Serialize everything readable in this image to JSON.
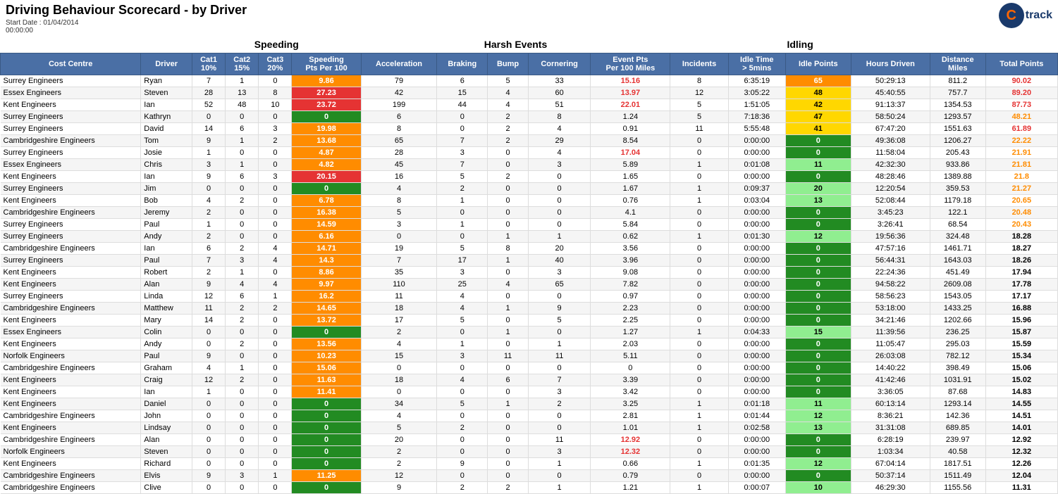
{
  "title": "Driving Behaviour Scorecard - by Driver",
  "date_label": "Start Date : 01/04/2014",
  "time_label": "00:00:00",
  "logo_c": "C",
  "logo_track": "track",
  "section_headers": [
    {
      "label": "",
      "colspan": 2
    },
    {
      "label": "Speeding",
      "colspan": 4
    },
    {
      "label": "Harsh Events",
      "colspan": 5
    },
    {
      "label": "Idling",
      "colspan": 4
    },
    {
      "label": "",
      "colspan": 3
    }
  ],
  "col_headers": [
    "Cost Centre",
    "Driver",
    "Cat1 10%",
    "Cat2 15%",
    "Cat3 20%",
    "Speeding Pts Per 100",
    "Acceleration",
    "Braking",
    "Bump",
    "Cornering",
    "Event Pts Per 100 Miles",
    "Incidents",
    "Idle Time > 5mins",
    "Idle Points",
    "Hours Driven",
    "Distance Miles",
    "Total Points"
  ],
  "rows": [
    {
      "cost_centre": "Surrey Engineers",
      "driver": "Ryan",
      "cat1": 7,
      "cat2": 1,
      "cat3": 0,
      "speed_pts": "9.86",
      "speed_class": "orange",
      "accel": 79,
      "braking": 6,
      "bump": 5,
      "cornering": 33,
      "event_pts": "15.16",
      "event_class": "red",
      "incidents": 8,
      "idle_time": "6:35:19",
      "idle_pts": "65",
      "idle_pts_class": "orange",
      "hours": "50:29:13",
      "distance": "811.2",
      "total": "90.02",
      "total_class": "red"
    },
    {
      "cost_centre": "Essex Engineers",
      "driver": "Steven",
      "cat1": 28,
      "cat2": 13,
      "cat3": 8,
      "speed_pts": "27.23",
      "speed_class": "red",
      "accel": 42,
      "braking": 15,
      "bump": 4,
      "cornering": 60,
      "event_pts": "13.97",
      "event_class": "normal",
      "incidents": 12,
      "idle_time": "3:05:22",
      "idle_pts": "48",
      "idle_pts_class": "yellow",
      "hours": "45:40:55",
      "distance": "757.7",
      "total": "89.20",
      "total_class": "red"
    },
    {
      "cost_centre": "Kent Engineers",
      "driver": "Ian",
      "cat1": 52,
      "cat2": 48,
      "cat3": 10,
      "speed_pts": "23.72",
      "speed_class": "red",
      "accel": 199,
      "braking": 44,
      "bump": 4,
      "cornering": 51,
      "event_pts": "22.01",
      "event_class": "red",
      "incidents": 5,
      "idle_time": "1:51:05",
      "idle_pts": "42",
      "idle_pts_class": "yellow",
      "hours": "91:13:37",
      "distance": "1354.53",
      "total": "87.73",
      "total_class": "red"
    },
    {
      "cost_centre": "Surrey Engineers",
      "driver": "Kathryn",
      "cat1": 0,
      "cat2": 0,
      "cat3": 0,
      "speed_pts": "0",
      "speed_class": "green",
      "accel": 6,
      "braking": 0,
      "bump": 2,
      "cornering": 8,
      "event_pts": "1.24",
      "event_class": "normal",
      "incidents": 5,
      "idle_time": "7:18:36",
      "idle_pts": "47",
      "idle_pts_class": "yellow",
      "hours": "58:50:24",
      "distance": "1293.57",
      "total": "48.21",
      "total_class": "orange"
    },
    {
      "cost_centre": "Surrey Engineers",
      "driver": "David",
      "cat1": 14,
      "cat2": 6,
      "cat3": 3,
      "speed_pts": "19.98",
      "speed_class": "orange",
      "accel": 8,
      "braking": 0,
      "bump": 2,
      "cornering": 4,
      "event_pts": "0.91",
      "event_class": "normal",
      "incidents": 11,
      "idle_time": "5:55:48",
      "idle_pts": "41",
      "idle_pts_class": "yellow",
      "hours": "67:47:20",
      "distance": "1551.63",
      "total": "61.89",
      "total_class": "red"
    },
    {
      "cost_centre": "Cambridgeshire Engineers",
      "driver": "Tom",
      "cat1": 9,
      "cat2": 1,
      "cat3": 2,
      "speed_pts": "13.68",
      "speed_class": "orange",
      "accel": 65,
      "braking": 7,
      "bump": 2,
      "cornering": 29,
      "event_pts": "8.54",
      "event_class": "normal",
      "incidents": 0,
      "idle_time": "0:00:00",
      "idle_pts": "0",
      "idle_pts_class": "green",
      "hours": "49:36:08",
      "distance": "1206.27",
      "total": "22.22",
      "total_class": "yellow"
    },
    {
      "cost_centre": "Surrey Engineers",
      "driver": "Josie",
      "cat1": 1,
      "cat2": 0,
      "cat3": 0,
      "speed_pts": "4.87",
      "speed_class": "orange",
      "accel": 28,
      "braking": 3,
      "bump": 0,
      "cornering": 4,
      "event_pts": "17.04",
      "event_class": "red",
      "incidents": 0,
      "idle_time": "0:00:00",
      "idle_pts": "0",
      "idle_pts_class": "green",
      "hours": "11:58:04",
      "distance": "205.43",
      "total": "21.91",
      "total_class": "yellow"
    },
    {
      "cost_centre": "Essex Engineers",
      "driver": "Chris",
      "cat1": 3,
      "cat2": 1,
      "cat3": 0,
      "speed_pts": "4.82",
      "speed_class": "orange",
      "accel": 45,
      "braking": 7,
      "bump": 0,
      "cornering": 3,
      "event_pts": "5.89",
      "event_class": "normal",
      "incidents": 1,
      "idle_time": "0:01:08",
      "idle_pts": "11",
      "idle_pts_class": "lime",
      "hours": "42:32:30",
      "distance": "933.86",
      "total": "21.81",
      "total_class": "yellow"
    },
    {
      "cost_centre": "Kent Engineers",
      "driver": "Ian",
      "cat1": 9,
      "cat2": 6,
      "cat3": 3,
      "speed_pts": "20.15",
      "speed_class": "red",
      "accel": 16,
      "braking": 5,
      "bump": 2,
      "cornering": 0,
      "event_pts": "1.65",
      "event_class": "normal",
      "incidents": 0,
      "idle_time": "0:00:00",
      "idle_pts": "0",
      "idle_pts_class": "green",
      "hours": "48:28:46",
      "distance": "1389.88",
      "total": "21.8",
      "total_class": "yellow"
    },
    {
      "cost_centre": "Surrey Engineers",
      "driver": "Jim",
      "cat1": 0,
      "cat2": 0,
      "cat3": 0,
      "speed_pts": "0",
      "speed_class": "green",
      "accel": 4,
      "braking": 2,
      "bump": 0,
      "cornering": 0,
      "event_pts": "1.67",
      "event_class": "normal",
      "incidents": 1,
      "idle_time": "0:09:37",
      "idle_pts": "20",
      "idle_pts_class": "lime",
      "hours": "12:20:54",
      "distance": "359.53",
      "total": "21.27",
      "total_class": "yellow"
    },
    {
      "cost_centre": "Kent Engineers",
      "driver": "Bob",
      "cat1": 4,
      "cat2": 2,
      "cat3": 0,
      "speed_pts": "6.78",
      "speed_class": "orange",
      "accel": 8,
      "braking": 1,
      "bump": 0,
      "cornering": 0,
      "event_pts": "0.76",
      "event_class": "normal",
      "incidents": 1,
      "idle_time": "0:03:04",
      "idle_pts": "13",
      "idle_pts_class": "lime",
      "hours": "52:08:44",
      "distance": "1179.18",
      "total": "20.65",
      "total_class": "yellow"
    },
    {
      "cost_centre": "Cambridgeshire Engineers",
      "driver": "Jeremy",
      "cat1": 2,
      "cat2": 0,
      "cat3": 0,
      "speed_pts": "16.38",
      "speed_class": "orange",
      "accel": 5,
      "braking": 0,
      "bump": 0,
      "cornering": 0,
      "event_pts": "4.1",
      "event_class": "normal",
      "incidents": 0,
      "idle_time": "0:00:00",
      "idle_pts": "0",
      "idle_pts_class": "green",
      "hours": "3:45:23",
      "distance": "122.1",
      "total": "20.48",
      "total_class": "yellow"
    },
    {
      "cost_centre": "Surrey Engineers",
      "driver": "Paul",
      "cat1": 1,
      "cat2": 0,
      "cat3": 0,
      "speed_pts": "14.59",
      "speed_class": "orange",
      "accel": 3,
      "braking": 1,
      "bump": 0,
      "cornering": 0,
      "event_pts": "5.84",
      "event_class": "normal",
      "incidents": 0,
      "idle_time": "0:00:00",
      "idle_pts": "0",
      "idle_pts_class": "green",
      "hours": "3:26:41",
      "distance": "68.54",
      "total": "20.43",
      "total_class": "yellow"
    },
    {
      "cost_centre": "Surrey Engineers",
      "driver": "Andy",
      "cat1": 2,
      "cat2": 0,
      "cat3": 0,
      "speed_pts": "6.16",
      "speed_class": "orange",
      "accel": 0,
      "braking": 0,
      "bump": 1,
      "cornering": 1,
      "event_pts": "0.62",
      "event_class": "normal",
      "incidents": 1,
      "idle_time": "0:01:30",
      "idle_pts": "12",
      "idle_pts_class": "lime",
      "hours": "19:56:36",
      "distance": "324.48",
      "total": "18.28",
      "total_class": "yellow"
    },
    {
      "cost_centre": "Cambridgeshire Engineers",
      "driver": "Ian",
      "cat1": 6,
      "cat2": 2,
      "cat3": 4,
      "speed_pts": "14.71",
      "speed_class": "orange",
      "accel": 19,
      "braking": 5,
      "bump": 8,
      "cornering": 20,
      "event_pts": "3.56",
      "event_class": "normal",
      "incidents": 0,
      "idle_time": "0:00:00",
      "idle_pts": "0",
      "idle_pts_class": "green",
      "hours": "47:57:16",
      "distance": "1461.71",
      "total": "18.27",
      "total_class": "yellow"
    },
    {
      "cost_centre": "Surrey Engineers",
      "driver": "Paul",
      "cat1": 7,
      "cat2": 3,
      "cat3": 4,
      "speed_pts": "14.3",
      "speed_class": "orange",
      "accel": 7,
      "braking": 17,
      "bump": 1,
      "cornering": 40,
      "event_pts": "3.96",
      "event_class": "normal",
      "incidents": 0,
      "idle_time": "0:00:00",
      "idle_pts": "0",
      "idle_pts_class": "green",
      "hours": "56:44:31",
      "distance": "1643.03",
      "total": "18.26",
      "total_class": "yellow"
    },
    {
      "cost_centre": "Kent Engineers",
      "driver": "Robert",
      "cat1": 2,
      "cat2": 1,
      "cat3": 0,
      "speed_pts": "8.86",
      "speed_class": "orange",
      "accel": 35,
      "braking": 3,
      "bump": 0,
      "cornering": 3,
      "event_pts": "9.08",
      "event_class": "normal",
      "incidents": 0,
      "idle_time": "0:00:00",
      "idle_pts": "0",
      "idle_pts_class": "green",
      "hours": "22:24:36",
      "distance": "451.49",
      "total": "17.94",
      "total_class": "yellow"
    },
    {
      "cost_centre": "Kent Engineers",
      "driver": "Alan",
      "cat1": 9,
      "cat2": 4,
      "cat3": 4,
      "speed_pts": "9.97",
      "speed_class": "orange",
      "accel": 110,
      "braking": 25,
      "bump": 4,
      "cornering": 65,
      "event_pts": "7.82",
      "event_class": "normal",
      "incidents": 0,
      "idle_time": "0:00:00",
      "idle_pts": "0",
      "idle_pts_class": "green",
      "hours": "94:58:22",
      "distance": "2609.08",
      "total": "17.78",
      "total_class": "yellow"
    },
    {
      "cost_centre": "Surrey Engineers",
      "driver": "Linda",
      "cat1": 12,
      "cat2": 6,
      "cat3": 1,
      "speed_pts": "16.2",
      "speed_class": "orange",
      "accel": 11,
      "braking": 4,
      "bump": 0,
      "cornering": 0,
      "event_pts": "0.97",
      "event_class": "normal",
      "incidents": 0,
      "idle_time": "0:00:00",
      "idle_pts": "0",
      "idle_pts_class": "green",
      "hours": "58:56:23",
      "distance": "1543.05",
      "total": "17.17",
      "total_class": "yellow"
    },
    {
      "cost_centre": "Cambridgeshire Engineers",
      "driver": "Matthew",
      "cat1": 11,
      "cat2": 2,
      "cat3": 2,
      "speed_pts": "14.65",
      "speed_class": "orange",
      "accel": 18,
      "braking": 4,
      "bump": 1,
      "cornering": 9,
      "event_pts": "2.23",
      "event_class": "normal",
      "incidents": 0,
      "idle_time": "0:00:00",
      "idle_pts": "0",
      "idle_pts_class": "green",
      "hours": "53:18:00",
      "distance": "1433.25",
      "total": "16.88",
      "total_class": "yellow"
    },
    {
      "cost_centre": "Kent Engineers",
      "driver": "Mary",
      "cat1": 14,
      "cat2": 2,
      "cat3": 0,
      "speed_pts": "13.72",
      "speed_class": "orange",
      "accel": 17,
      "braking": 5,
      "bump": 0,
      "cornering": 5,
      "event_pts": "2.25",
      "event_class": "normal",
      "incidents": 0,
      "idle_time": "0:00:00",
      "idle_pts": "0",
      "idle_pts_class": "green",
      "hours": "34:21:46",
      "distance": "1202.66",
      "total": "15.96",
      "total_class": "yellow"
    },
    {
      "cost_centre": "Essex Engineers",
      "driver": "Colin",
      "cat1": 0,
      "cat2": 0,
      "cat3": 0,
      "speed_pts": "0",
      "speed_class": "green",
      "accel": 2,
      "braking": 0,
      "bump": 1,
      "cornering": 0,
      "event_pts": "1.27",
      "event_class": "normal",
      "incidents": 1,
      "idle_time": "0:04:33",
      "idle_pts": "15",
      "idle_pts_class": "lime",
      "hours": "11:39:56",
      "distance": "236.25",
      "total": "15.87",
      "total_class": "yellow"
    },
    {
      "cost_centre": "Kent Engineers",
      "driver": "Andy",
      "cat1": 0,
      "cat2": 2,
      "cat3": 0,
      "speed_pts": "13.56",
      "speed_class": "orange",
      "accel": 4,
      "braking": 1,
      "bump": 0,
      "cornering": 1,
      "event_pts": "2.03",
      "event_class": "normal",
      "incidents": 0,
      "idle_time": "0:00:00",
      "idle_pts": "0",
      "idle_pts_class": "green",
      "hours": "11:05:47",
      "distance": "295.03",
      "total": "15.59",
      "total_class": "yellow"
    },
    {
      "cost_centre": "Norfolk Engineers",
      "driver": "Paul",
      "cat1": 9,
      "cat2": 0,
      "cat3": 0,
      "speed_pts": "10.23",
      "speed_class": "orange",
      "accel": 15,
      "braking": 3,
      "bump": 11,
      "cornering": 11,
      "event_pts": "5.11",
      "event_class": "normal",
      "incidents": 0,
      "idle_time": "0:00:00",
      "idle_pts": "0",
      "idle_pts_class": "green",
      "hours": "26:03:08",
      "distance": "782.12",
      "total": "15.34",
      "total_class": "yellow"
    },
    {
      "cost_centre": "Cambridgeshire Engineers",
      "driver": "Graham",
      "cat1": 4,
      "cat2": 1,
      "cat3": 0,
      "speed_pts": "15.06",
      "speed_class": "orange",
      "accel": 0,
      "braking": 0,
      "bump": 0,
      "cornering": 0,
      "event_pts": "0",
      "event_class": "normal",
      "incidents": 0,
      "idle_time": "0:00:00",
      "idle_pts": "0",
      "idle_pts_class": "green",
      "hours": "14:40:22",
      "distance": "398.49",
      "total": "15.06",
      "total_class": "yellow"
    },
    {
      "cost_centre": "Kent Engineers",
      "driver": "Craig",
      "cat1": 12,
      "cat2": 2,
      "cat3": 0,
      "speed_pts": "11.63",
      "speed_class": "orange",
      "accel": 18,
      "braking": 4,
      "bump": 6,
      "cornering": 7,
      "event_pts": "3.39",
      "event_class": "normal",
      "incidents": 0,
      "idle_time": "0:00:00",
      "idle_pts": "0",
      "idle_pts_class": "green",
      "hours": "41:42:46",
      "distance": "1031.91",
      "total": "15.02",
      "total_class": "yellow"
    },
    {
      "cost_centre": "Kent Engineers",
      "driver": "Ian",
      "cat1": 1,
      "cat2": 0,
      "cat3": 0,
      "speed_pts": "11.41",
      "speed_class": "orange",
      "accel": 0,
      "braking": 0,
      "bump": 0,
      "cornering": 3,
      "event_pts": "3.42",
      "event_class": "normal",
      "incidents": 0,
      "idle_time": "0:00:00",
      "idle_pts": "0",
      "idle_pts_class": "green",
      "hours": "3:36:05",
      "distance": "87.68",
      "total": "14.83",
      "total_class": "yellow"
    },
    {
      "cost_centre": "Kent Engineers",
      "driver": "Daniel",
      "cat1": 0,
      "cat2": 0,
      "cat3": 0,
      "speed_pts": "0",
      "speed_class": "green",
      "accel": 34,
      "braking": 5,
      "bump": 1,
      "cornering": 2,
      "event_pts": "3.25",
      "event_class": "normal",
      "incidents": 1,
      "idle_time": "0:01:18",
      "idle_pts": "11",
      "idle_pts_class": "lime",
      "hours": "60:13:14",
      "distance": "1293.14",
      "total": "14.55",
      "total_class": "yellow"
    },
    {
      "cost_centre": "Cambridgeshire Engineers",
      "driver": "John",
      "cat1": 0,
      "cat2": 0,
      "cat3": 0,
      "speed_pts": "0",
      "speed_class": "green",
      "accel": 4,
      "braking": 0,
      "bump": 0,
      "cornering": 0,
      "event_pts": "2.81",
      "event_class": "normal",
      "incidents": 1,
      "idle_time": "0:01:44",
      "idle_pts": "12",
      "idle_pts_class": "lime",
      "hours": "8:36:21",
      "distance": "142.36",
      "total": "14.51",
      "total_class": "yellow"
    },
    {
      "cost_centre": "Kent Engineers",
      "driver": "Lindsay",
      "cat1": 0,
      "cat2": 0,
      "cat3": 0,
      "speed_pts": "0",
      "speed_class": "green",
      "accel": 5,
      "braking": 2,
      "bump": 0,
      "cornering": 0,
      "event_pts": "1.01",
      "event_class": "normal",
      "incidents": 1,
      "idle_time": "0:02:58",
      "idle_pts": "13",
      "idle_pts_class": "lime",
      "hours": "31:31:08",
      "distance": "689.85",
      "total": "14.01",
      "total_class": "yellow"
    },
    {
      "cost_centre": "Cambridgeshire Engineers",
      "driver": "Alan",
      "cat1": 0,
      "cat2": 0,
      "cat3": 0,
      "speed_pts": "0",
      "speed_class": "green",
      "accel": 20,
      "braking": 0,
      "bump": 0,
      "cornering": 11,
      "event_pts": "12.92",
      "event_class": "red",
      "incidents": 0,
      "idle_time": "0:00:00",
      "idle_pts": "0",
      "idle_pts_class": "green",
      "hours": "6:28:19",
      "distance": "239.97",
      "total": "12.92",
      "total_class": "yellow"
    },
    {
      "cost_centre": "Norfolk Engineers",
      "driver": "Steven",
      "cat1": 0,
      "cat2": 0,
      "cat3": 0,
      "speed_pts": "0",
      "speed_class": "green",
      "accel": 2,
      "braking": 0,
      "bump": 0,
      "cornering": 3,
      "event_pts": "12.32",
      "event_class": "red",
      "incidents": 0,
      "idle_time": "0:00:00",
      "idle_pts": "0",
      "idle_pts_class": "green",
      "hours": "1:03:34",
      "distance": "40.58",
      "total": "12.32",
      "total_class": "yellow"
    },
    {
      "cost_centre": "Kent Engineers",
      "driver": "Richard",
      "cat1": 0,
      "cat2": 0,
      "cat3": 0,
      "speed_pts": "0",
      "speed_class": "green",
      "accel": 2,
      "braking": 9,
      "bump": 0,
      "cornering": 1,
      "event_pts": "0.66",
      "event_class": "normal",
      "incidents": 1,
      "idle_time": "0:01:35",
      "idle_pts": "12",
      "idle_pts_class": "lime",
      "hours": "67:04:14",
      "distance": "1817.51",
      "total": "12.26",
      "total_class": "yellow"
    },
    {
      "cost_centre": "Cambridgeshire Engineers",
      "driver": "Elvis",
      "cat1": 9,
      "cat2": 3,
      "cat3": 1,
      "speed_pts": "11.25",
      "speed_class": "orange",
      "accel": 12,
      "braking": 0,
      "bump": 0,
      "cornering": 0,
      "event_pts": "0.79",
      "event_class": "normal",
      "incidents": 0,
      "idle_time": "0:00:00",
      "idle_pts": "0",
      "idle_pts_class": "green",
      "hours": "50:37:14",
      "distance": "1511.49",
      "total": "12.04",
      "total_class": "yellow"
    },
    {
      "cost_centre": "Cambridgeshire Engineers",
      "driver": "Clive",
      "cat1": 0,
      "cat2": 0,
      "cat3": 0,
      "speed_pts": "0",
      "speed_class": "green",
      "accel": 9,
      "braking": 2,
      "bump": 2,
      "cornering": 1,
      "event_pts": "1.21",
      "event_class": "normal",
      "incidents": 1,
      "idle_time": "0:00:07",
      "idle_pts": "10",
      "idle_pts_class": "lime",
      "hours": "46:29:30",
      "distance": "1155.56",
      "total": "11.31",
      "total_class": "yellow"
    }
  ]
}
